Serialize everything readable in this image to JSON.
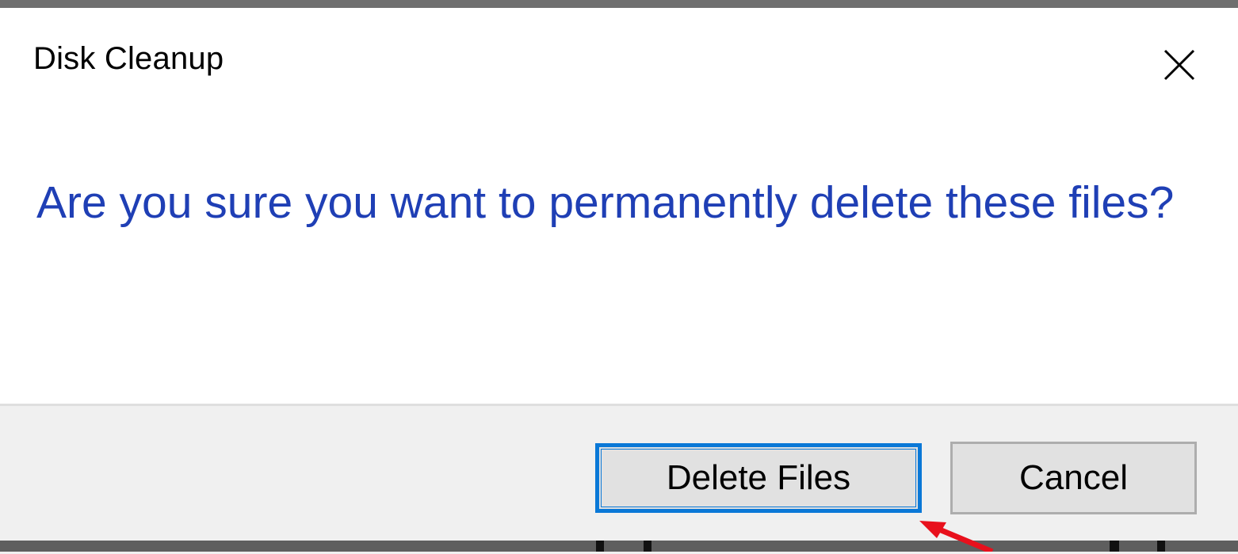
{
  "window": {
    "title": "Disk Cleanup"
  },
  "icons": {
    "close": "close-icon",
    "annotation": "red-arrow-annotation"
  },
  "dialog": {
    "message": "Are you sure you want to permanently delete these files?"
  },
  "buttons": {
    "delete_label": "Delete Files",
    "cancel_label": "Cancel"
  },
  "colors": {
    "message_text": "#1f3fb5",
    "focus_border": "#0a78d7",
    "footer_bg": "#f0f0f0",
    "button_bg": "#e1e1e1",
    "annotation_arrow": "#e8101c"
  }
}
